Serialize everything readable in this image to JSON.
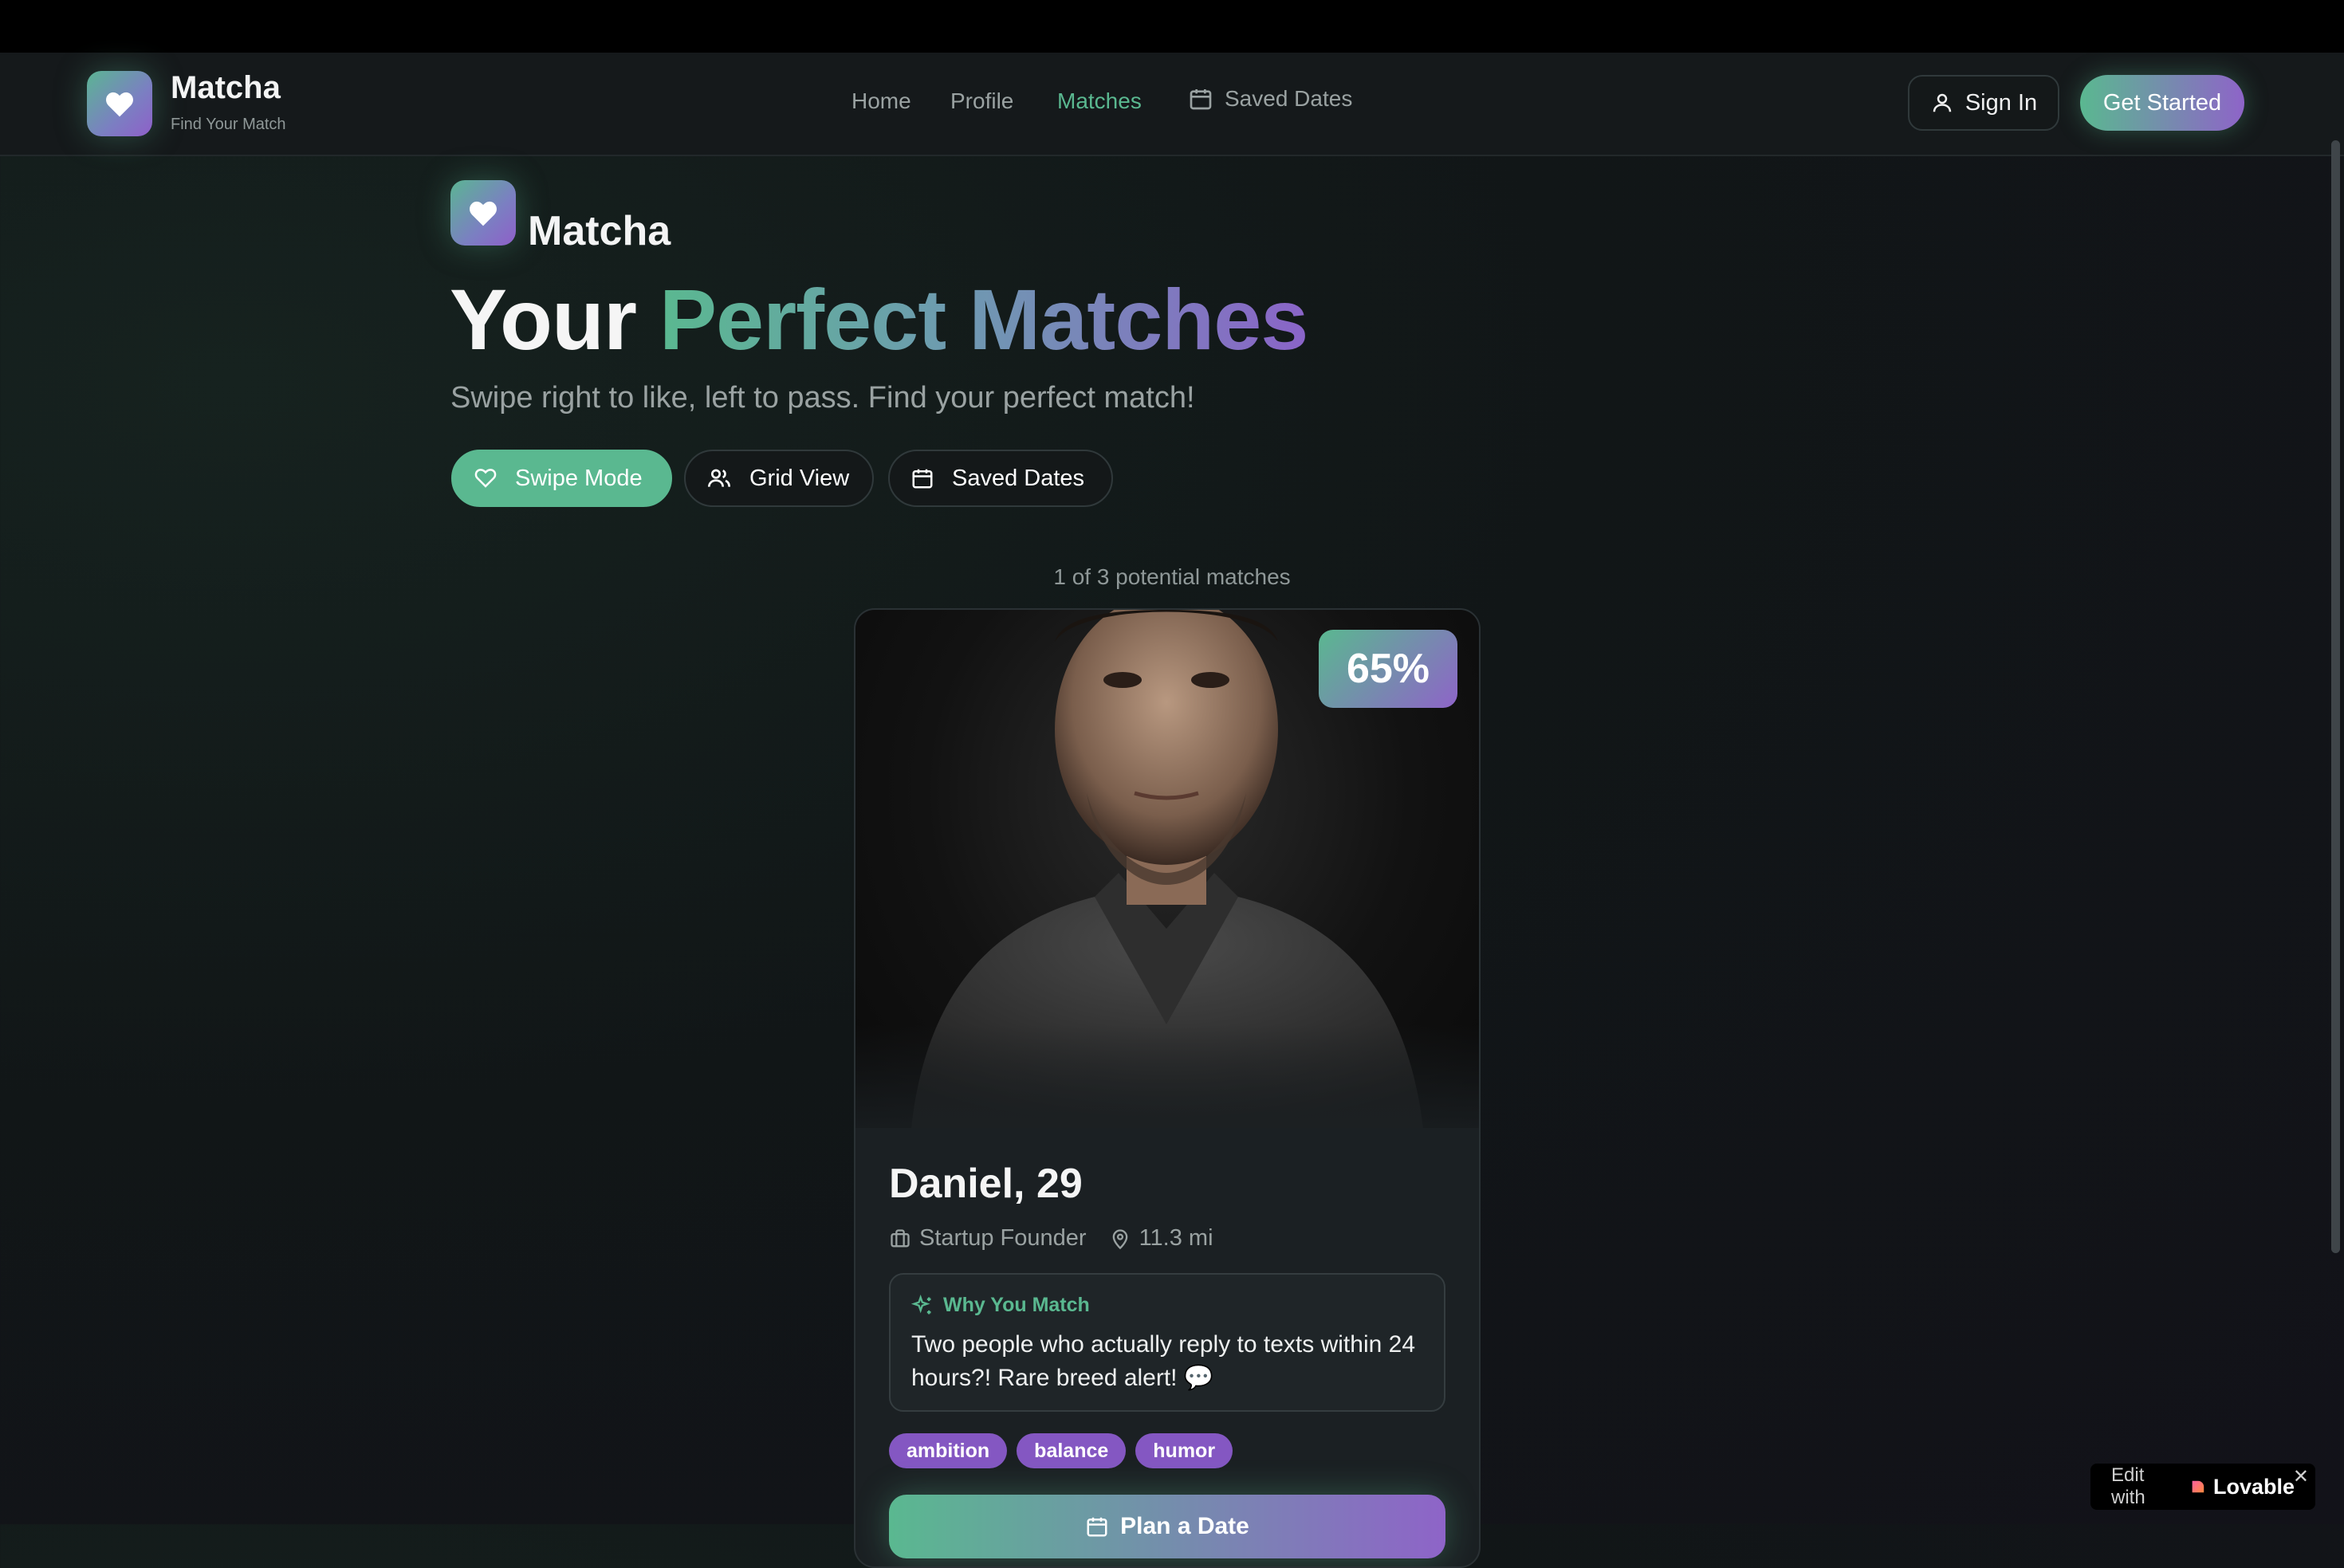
{
  "app": {
    "name": "Matcha",
    "tagline": "Find Your Match"
  },
  "nav": {
    "links": [
      {
        "label": "Home"
      },
      {
        "label": "Profile"
      },
      {
        "label": "Matches",
        "active": true
      },
      {
        "label": "Saved Dates",
        "icon": "calendar-icon"
      }
    ],
    "sign_in": "Sign In",
    "get_started": "Get Started"
  },
  "hero": {
    "brand": "Matcha",
    "headline_part1": "Your",
    "headline_part2": "Perfect Matches",
    "subtitle": "Swipe right to like, left to pass. Find your perfect match!",
    "modes": [
      {
        "label": "Swipe Mode",
        "icon": "heart-icon",
        "active": true
      },
      {
        "label": "Grid View",
        "icon": "users-icon"
      },
      {
        "label": "Saved Dates",
        "icon": "calendar-icon"
      }
    ]
  },
  "counter": "1 of 3 potential matches",
  "match_card": {
    "percent": "65%",
    "name_age": "Daniel, 29",
    "occupation": "Startup Founder",
    "distance": "11.3 mi",
    "why_title": "Why You Match",
    "why_text": "Two people who actually reply to texts within 24 hours?! Rare breed alert! 💬",
    "tags": [
      "ambition",
      "balance",
      "humor"
    ],
    "plan_button": "Plan a Date"
  },
  "lovable": {
    "prefix": "Edit with",
    "brand": "Lovable"
  },
  "colors": {
    "accent_green": "#5ab890",
    "accent_purple": "#8e64c8",
    "background": "#111617"
  }
}
